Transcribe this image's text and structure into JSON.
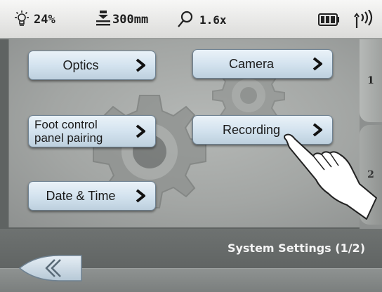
{
  "status_bar": {
    "brightness": "24%",
    "focus_distance": "300mm",
    "zoom": "1.6x",
    "icons": [
      "brightness-icon",
      "focus-distance-icon",
      "magnifier-icon",
      "battery-icon",
      "wireless-signal-icon"
    ]
  },
  "buttons": {
    "optics": "Optics",
    "camera": "Camera",
    "foot_control_line1": "Foot control",
    "foot_control_line2": "panel pairing",
    "recording": "Recording",
    "date_time": "Date & Time"
  },
  "tabs": [
    {
      "label": "1",
      "active": true
    },
    {
      "label": "2",
      "active": false
    }
  ],
  "footer": {
    "title": "System Settings (1/2)",
    "back_icon": "double-chevron-left-icon"
  },
  "colors": {
    "button_fill": "#d4e3ef",
    "panel_bg": "#a3a6a4",
    "title_text": "#f4f4f4"
  }
}
